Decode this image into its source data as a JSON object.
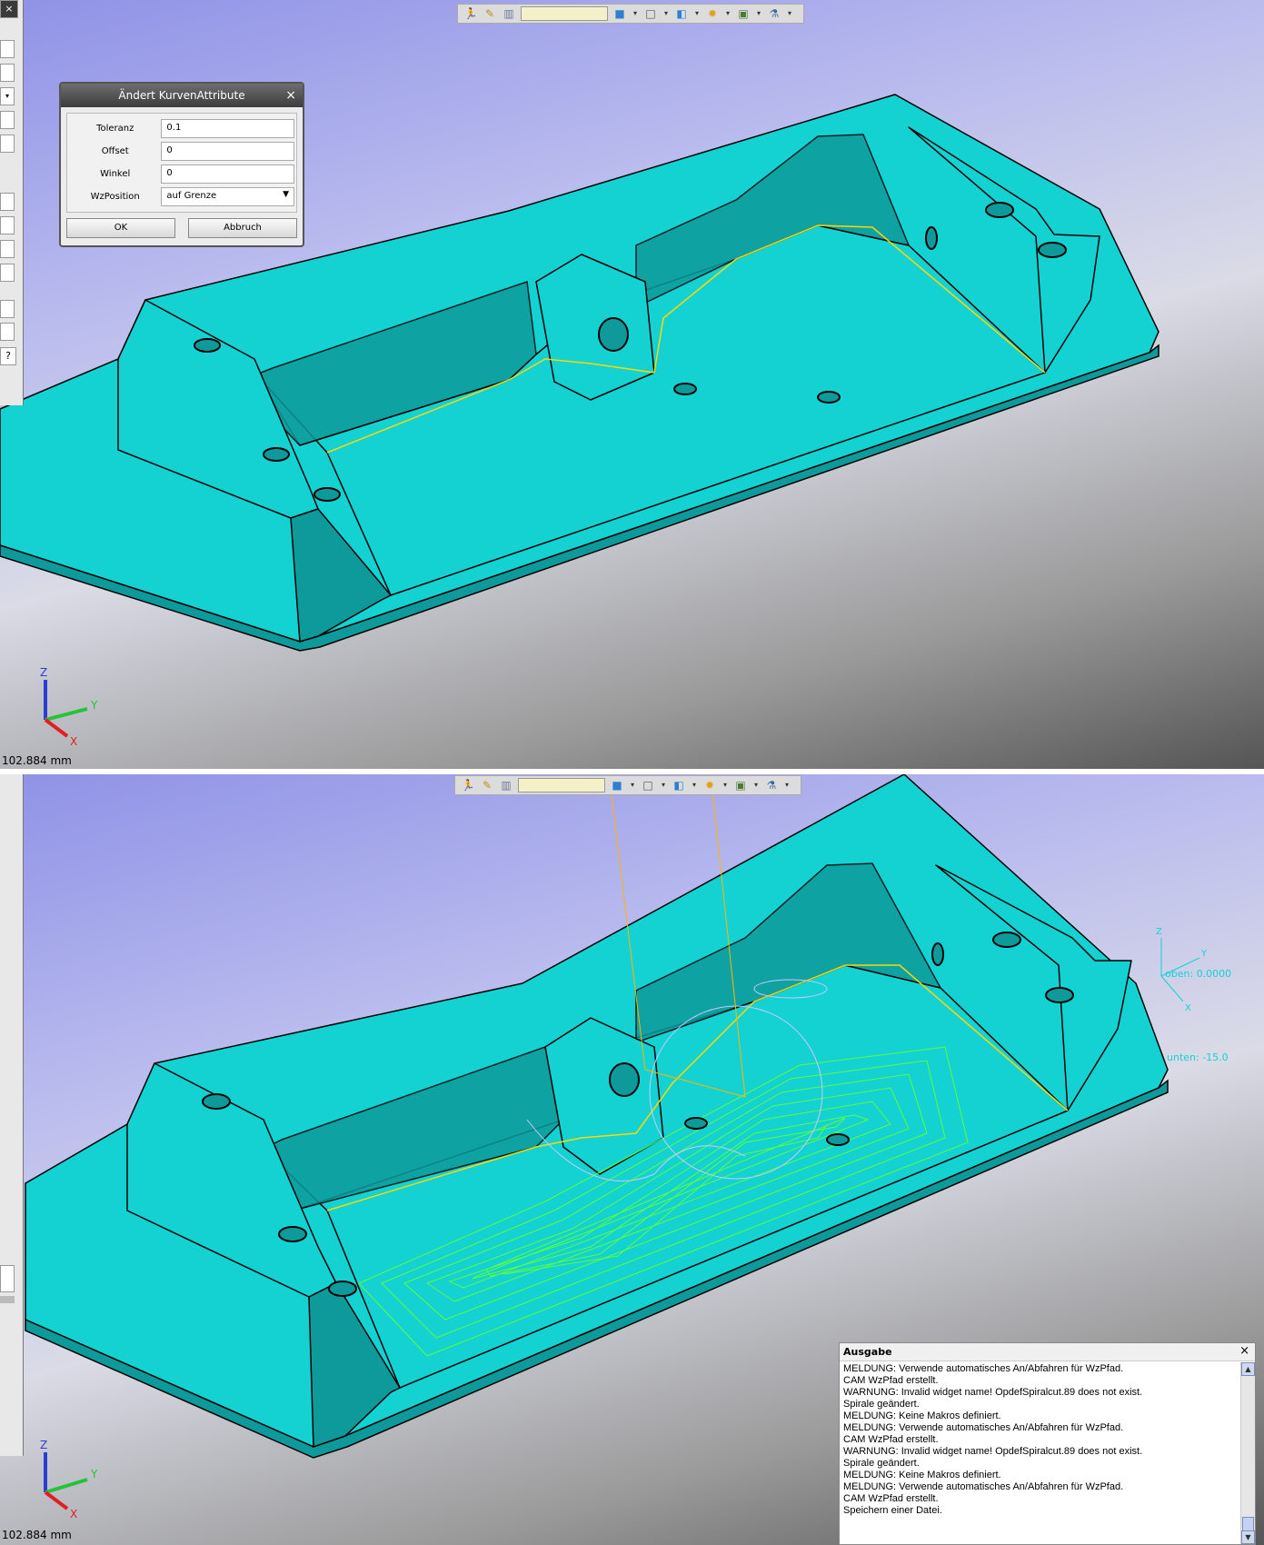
{
  "colors": {
    "model": "#14d2d2",
    "model_dark": "#0e9a9a",
    "model_edge": "#000000",
    "contour": "#ffd700",
    "toolpath": "#5cff3a",
    "toolpath_light": "#c8c8ff",
    "tool_axis": "#ffb400"
  },
  "toolbar": {
    "icons": [
      "walk-icon",
      "measure-icon",
      "chart-icon",
      "view-cube-icon",
      "wire-cube-icon",
      "shaded-cube-icon",
      "render-icon",
      "frame-icon",
      "light-icon"
    ]
  },
  "dialog": {
    "title": "Ändert KurvenAttribute",
    "close": "×",
    "fields": [
      {
        "label": "Toleranz",
        "value": "0.1"
      },
      {
        "label": "Offset",
        "value": "0"
      },
      {
        "label": "Winkel",
        "value": "0"
      }
    ],
    "position": {
      "label": "WzPosition",
      "value": "auf Grenze"
    },
    "ok": "OK",
    "cancel": "Abbruch"
  },
  "axes": {
    "z": "Z",
    "y": "Y",
    "x": "X"
  },
  "scale_top": "102.884 mm",
  "scale_bottom": "102.884 mm",
  "annotations": {
    "oben": "oben: 0.0000",
    "unten": "unten: -15.0"
  },
  "side_panel": {
    "close": "×",
    "help": "?"
  },
  "output": {
    "title": "Ausgabe",
    "close": "×",
    "lines": [
      "MELDUNG: Verwende automatisches An/Abfahren für WzPfad.",
      "CAM WzPfad erstellt.",
      "WARNUNG: Invalid widget name! OpdefSpiralcut.89 does not exist.",
      "Spirale geändert.",
      "MELDUNG: Keine Makros definiert.",
      "MELDUNG: Verwende automatisches An/Abfahren für WzPfad.",
      "CAM WzPfad erstellt.",
      "WARNUNG: Invalid widget name! OpdefSpiralcut.89 does not exist.",
      "Spirale geändert.",
      "MELDUNG: Keine Makros definiert.",
      "MELDUNG: Verwende automatisches An/Abfahren für WzPfad.",
      "CAM WzPfad erstellt.",
      "Speichern einer Datei."
    ]
  }
}
